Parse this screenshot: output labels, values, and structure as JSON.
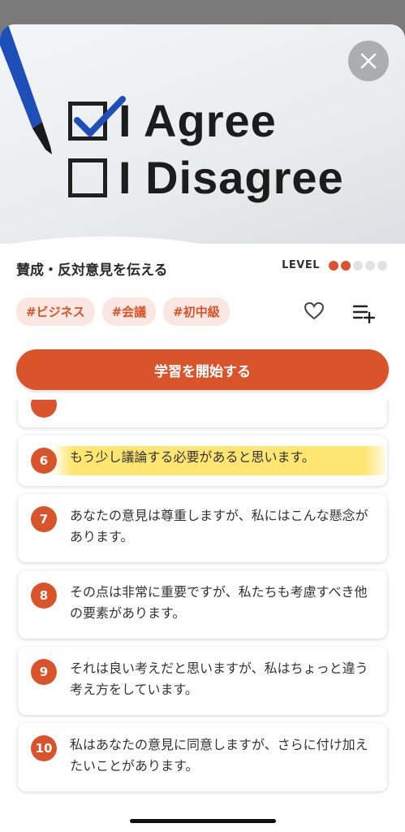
{
  "hero": {
    "agree_text": "I Agree",
    "disagree_text": "I Disagree"
  },
  "lesson": {
    "title": "賛成・反対意見を伝える",
    "level_label": "LEVEL",
    "level": 2,
    "level_max": 5,
    "tags": [
      "#ビジネス",
      "#会議",
      "#初中級"
    ]
  },
  "start_button_label": "学習を開始する",
  "phrases": [
    {
      "number": "6",
      "text": "もう少し議論する必要があると思います。",
      "highlighted": true
    },
    {
      "number": "7",
      "text": "あなたの意見は尊重しますが、私にはこんな懸念があります。"
    },
    {
      "number": "8",
      "text": "その点は非常に重要ですが、私たちも考慮すべき他の要素があります。"
    },
    {
      "number": "9",
      "text": "それは良い考えだと思いますが、私はちょっと違う考え方をしています。"
    },
    {
      "number": "10",
      "text": "私はあなたの意見に同意しますが、さらに付け加えたいことがあります。"
    }
  ],
  "colors": {
    "accent": "#d9532b",
    "tag_bg": "#fbe7e2",
    "highlight": "#ffe25a"
  }
}
